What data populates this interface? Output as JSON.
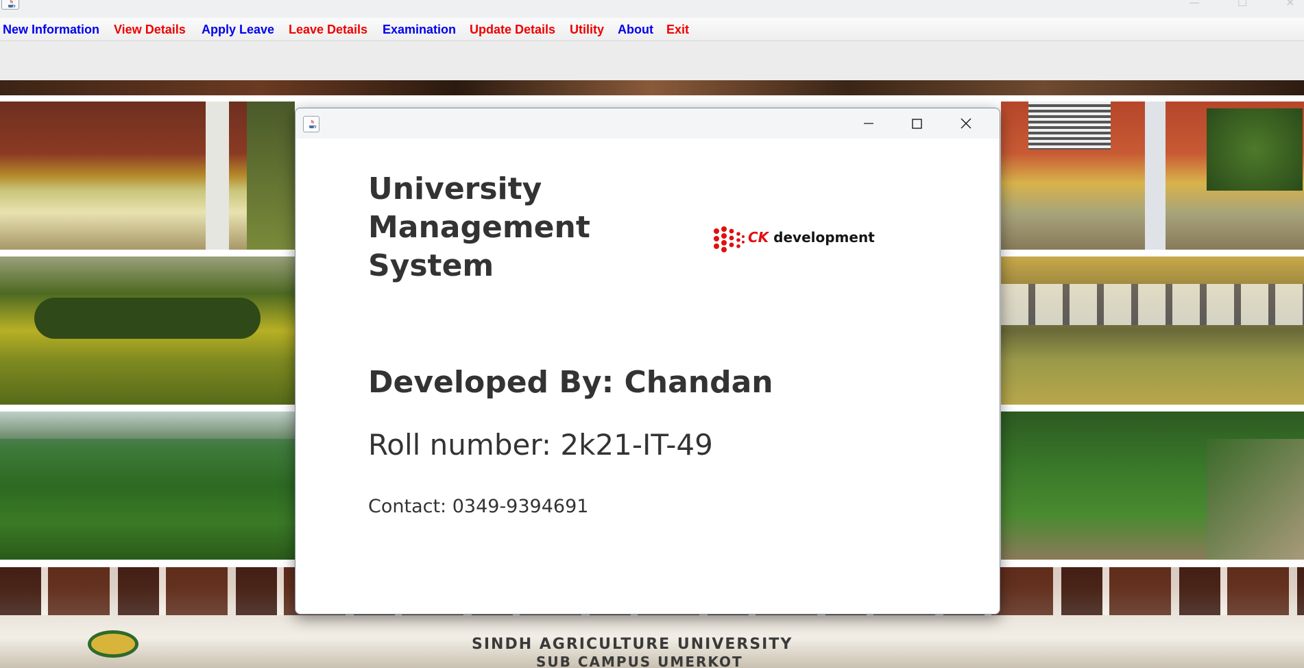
{
  "window": {
    "controls": {
      "minimize": "—",
      "maximize": "☐",
      "close": "✕"
    }
  },
  "menubar": {
    "items": [
      {
        "label": "New Information",
        "color": "#0000ee"
      },
      {
        "label": "View Details",
        "color": "#ee0000"
      },
      {
        "label": "Apply Leave",
        "color": "#0000ee"
      },
      {
        "label": "Leave Details",
        "color": "#ee0000"
      },
      {
        "label": "Examination",
        "color": "#0000ee"
      },
      {
        "label": "Update Details",
        "color": "#ee0000"
      },
      {
        "label": "Utility",
        "color": "#ee0000"
      },
      {
        "label": "About",
        "color": "#0000ee"
      },
      {
        "label": "Exit",
        "color": "#ee0000"
      }
    ]
  },
  "background": {
    "banner_line1": "SINDH AGRICULTURE UNIVERSITY",
    "banner_line2": "SUB CAMPUS UMERKOT"
  },
  "about_dialog": {
    "title_line1": "University",
    "title_line2": "Management",
    "title_line3": "System",
    "logo": {
      "ck": "CK",
      "development": "development",
      "accent": "#e01010"
    },
    "developed_by": "Developed By: Chandan",
    "roll_number": "Roll number: 2k21-IT-49",
    "contact": "Contact: 0349-9394691",
    "icons": [
      "java-icon",
      "minimize-icon",
      "maximize-icon",
      "close-icon"
    ]
  }
}
